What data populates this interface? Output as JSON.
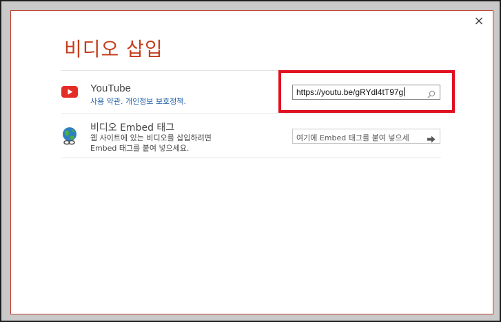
{
  "dialog": {
    "title": "비디오 삽입",
    "close_label": "×"
  },
  "youtube": {
    "icon": "youtube-icon",
    "title": "YouTube",
    "links": [
      "사용 약관",
      "개인정보 보호정책"
    ],
    "link_separator": ". ",
    "link_end": ".",
    "input_value": "https://youtu.be/gRYdl4tT97g",
    "search_icon": "search-icon"
  },
  "embed": {
    "icon": "globe-link-icon",
    "title": "비디오 Embed 태그",
    "description": "웹 사이트에 있는 비디오를 삽입하려면 Embed 태그를 붙여 넣으세요.",
    "placeholder": "여기에 Embed 태그를 붙여 넣으세",
    "go_icon": "arrow-right-icon"
  },
  "colors": {
    "title": "#c43e1c",
    "highlight": "#e01020",
    "youtube_red": "#e52d27",
    "link": "#1f5fa8"
  }
}
